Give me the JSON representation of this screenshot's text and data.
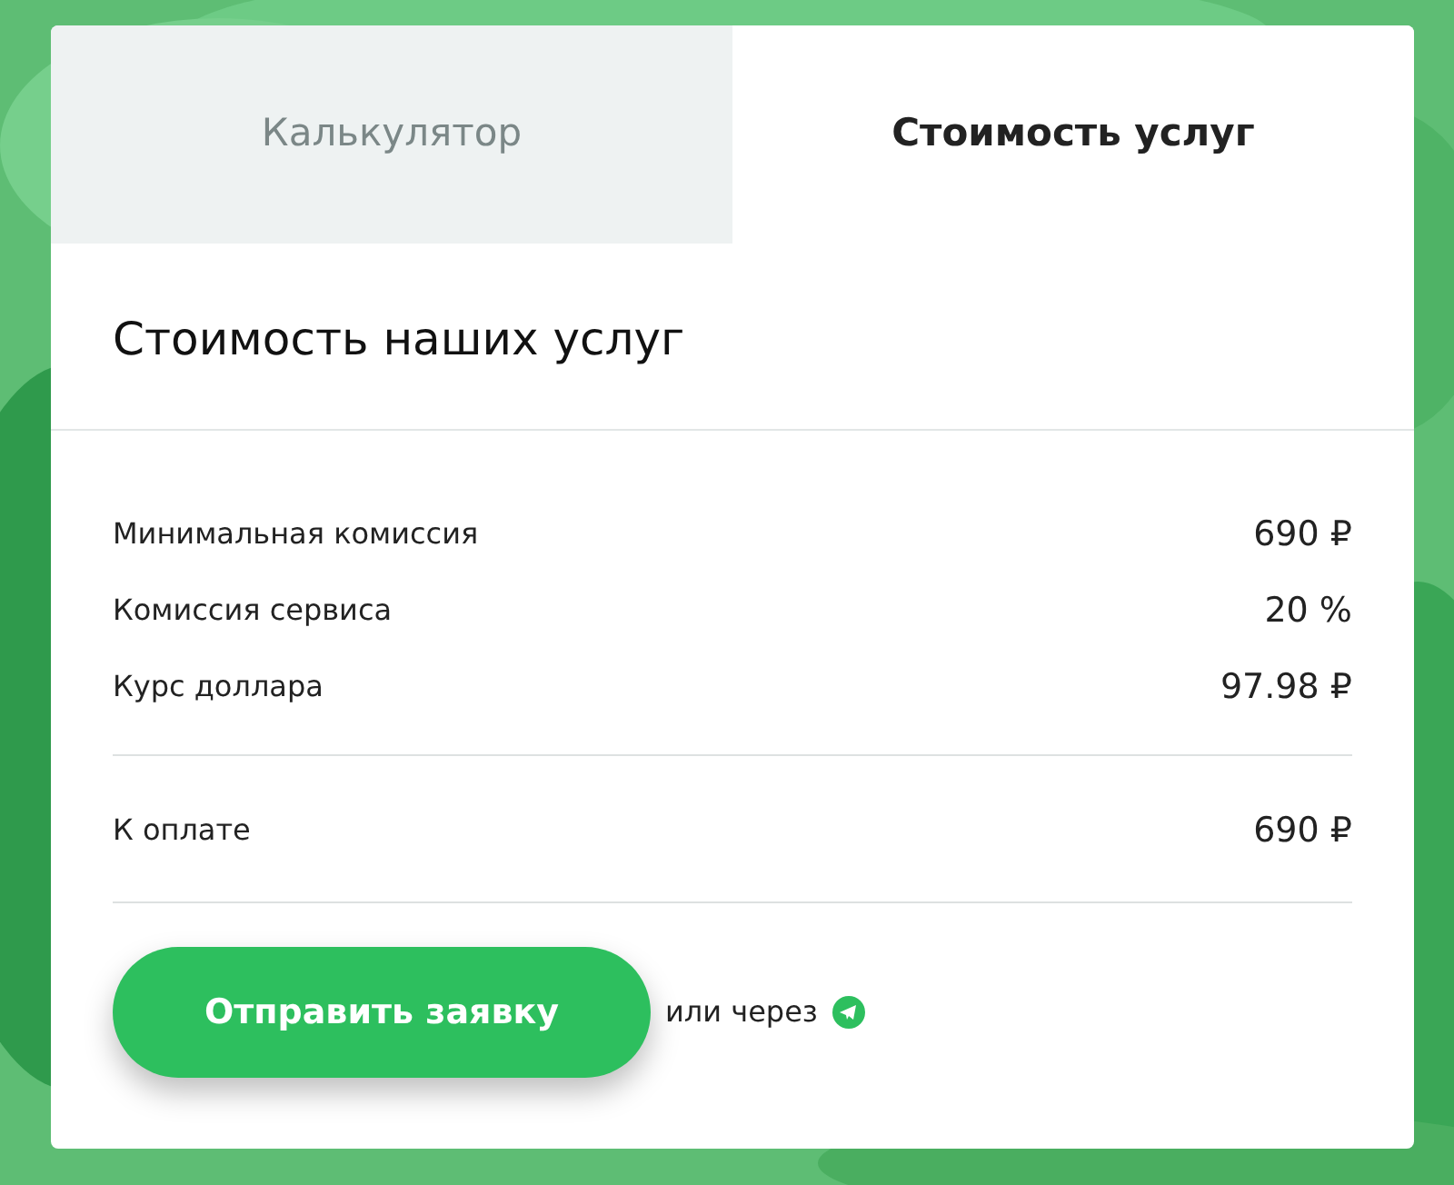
{
  "tabs": [
    {
      "label": "Калькулятор",
      "selected": false
    },
    {
      "label": "Стоимость услуг",
      "selected": true
    }
  ],
  "title": "Стоимость наших услуг",
  "rates": [
    {
      "label": "Минимальная комиссия",
      "value": "690 ₽"
    },
    {
      "label": "Комиссия сервиса",
      "value": "20 %"
    },
    {
      "label": "Курс доллара",
      "value": "97.98 ₽"
    }
  ],
  "total": {
    "label": "К оплате",
    "value": "690 ₽"
  },
  "submit_button": "Отправить заявку",
  "alt_text": "или через"
}
